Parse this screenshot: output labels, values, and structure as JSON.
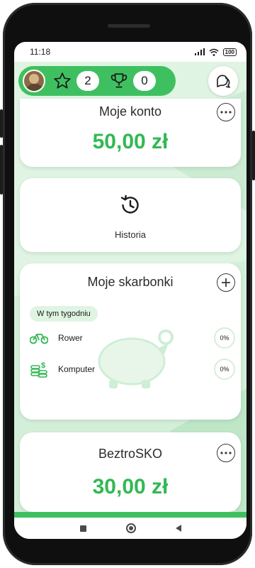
{
  "status_bar": {
    "time": "11:18",
    "battery": "100"
  },
  "header": {
    "stars_count": "2",
    "trophies_count": "0"
  },
  "account_card": {
    "title": "Moje konto",
    "balance": "50,00 zł"
  },
  "history_card": {
    "label": "Historia"
  },
  "piggy_banks_card": {
    "title": "Moje skarbonki",
    "week_chip": "W tym tygodniu",
    "goals": [
      {
        "label": "Rower",
        "percent": "0%",
        "icon": "bicycle-icon"
      },
      {
        "label": "Komputer",
        "percent": "0%",
        "icon": "coins-dollar-icon"
      }
    ]
  },
  "bezstresko_card": {
    "title": "BeztroSKO",
    "balance": "30,00 zł"
  },
  "colors": {
    "brand_green": "#3fc060",
    "amount_green": "#33b854",
    "background_green": "#dff4e2"
  }
}
